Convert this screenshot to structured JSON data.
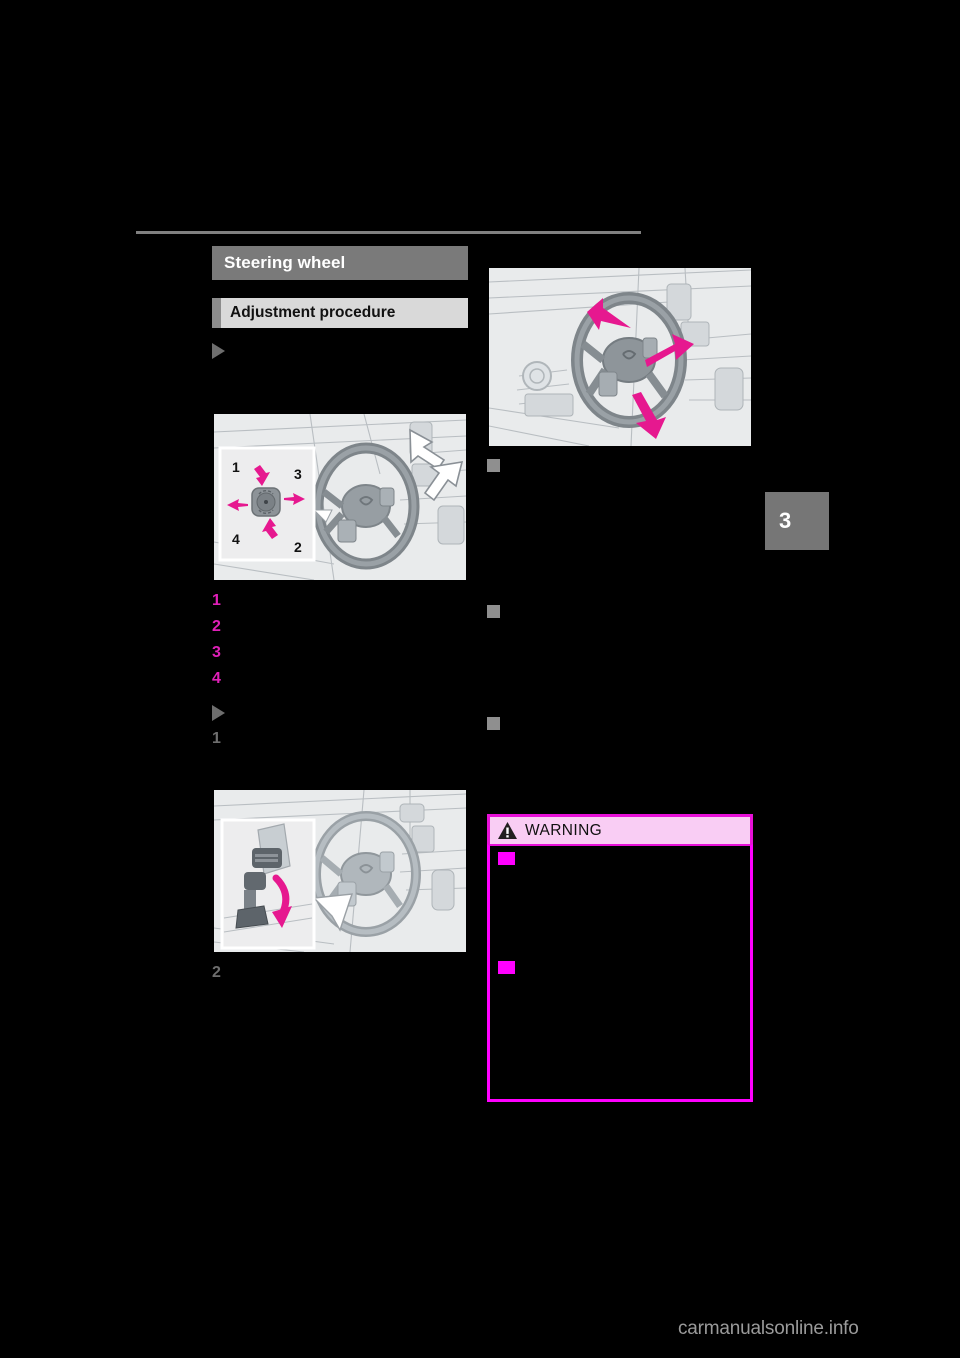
{
  "document": {
    "kind": "car-owner-manual-page",
    "chapter_tab": "3",
    "watermark": "carmanualsonline.info"
  },
  "left_column": {
    "section_title": "Steering wheel",
    "sub_heading": "Adjustment procedure",
    "intro_marker": "▶",
    "figure1": {
      "caption_numbers": [
        "1",
        "2",
        "3",
        "4"
      ],
      "alt": "Steering wheel with inset showing four-way adjustment switch; arrows numbered 1 up, 2 down, 3 right, 4 left",
      "labels": [
        "1",
        "2",
        "3",
        "4"
      ]
    },
    "steps_after_fig1": [
      {
        "num": "1",
        "text": ""
      },
      {
        "num": "2",
        "text": ""
      },
      {
        "num": "3",
        "text": ""
      },
      {
        "num": "4",
        "text": ""
      }
    ],
    "second_marker": "▶",
    "manual_steps": [
      {
        "num": "1",
        "text": ""
      },
      {
        "num": "2",
        "text": ""
      }
    ],
    "figure2": {
      "alt": "Inset of steering column lock lever being pushed down, magenta curved arrow"
    }
  },
  "right_column": {
    "figure3": {
      "alt": "Steering wheel with magenta arrows showing tilt and telescopic movement directions"
    },
    "subsections": [
      {
        "bullet": "■",
        "heading": "",
        "body": ""
      },
      {
        "bullet": "■",
        "heading": "",
        "body": ""
      },
      {
        "bullet": "■",
        "heading": "",
        "body": ""
      }
    ]
  },
  "warning": {
    "title": "WARNING",
    "icon": "warning-triangle",
    "bullets": [
      {
        "marker": "■",
        "text": ""
      },
      {
        "marker": "■",
        "text": ""
      }
    ]
  },
  "colors": {
    "accent_magenta": "#ff00ff",
    "warning_header_bg": "#f9cdf4",
    "warning_border": "#e810d8",
    "section_title_bg": "#7a7a7a",
    "sub_heading_bg": "#d9d9d9",
    "sub_heading_accent": "#8c8c8c",
    "marker_gray": "#6e6e6e",
    "page_bg": "#000000",
    "figure_bg": "#e9ebec",
    "watermark": "#9a9a9a"
  }
}
